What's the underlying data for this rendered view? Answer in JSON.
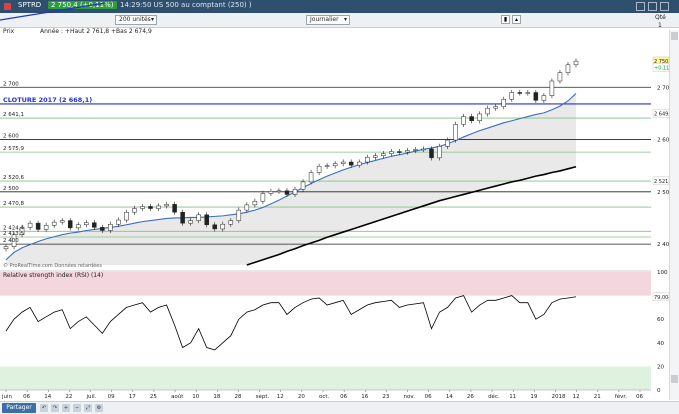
{
  "window": {
    "title": "SPTRD",
    "price_badge": "2 750,4 (+0,11%)",
    "info": "14:29:50 US 500 au comptant (250) )"
  },
  "toolbar": {
    "units_select": "200 unités",
    "period_select": "Journalier",
    "qte_label": "Qté",
    "qte_value": "1"
  },
  "chart_data": [
    {
      "type": "line",
      "x": [
        "juin",
        "06",
        "14",
        "22",
        "juil.",
        "09",
        "17",
        "25",
        "août",
        "10",
        "18",
        "28",
        "sept.",
        "12",
        "20",
        "oct.",
        "06",
        "16",
        "23",
        "nov.",
        "06",
        "14",
        "26",
        "déc.",
        "11",
        "19",
        "2018",
        "12",
        "21",
        "févr.",
        "06"
      ],
      "ylim": [
        2360,
        2800
      ],
      "yticks": [
        2700,
        2600,
        2500,
        2400
      ],
      "ytick_labels": [
        "2 700",
        "2 600",
        "2 500",
        "2 400"
      ],
      "corner_label": "Prix",
      "header_text": "Année : +Haut 2 761,8 +Bas 2 674,9",
      "series": [
        {
          "name": "",
          "color": "#111111",
          "values": [
            2395,
            2418,
            2432,
            2440,
            2428,
            2436,
            2442,
            2445,
            2431,
            2437,
            2441,
            2432,
            2426,
            2438,
            2446,
            2461,
            2468,
            2472,
            2468,
            2473,
            2476,
            2461,
            2440,
            2445,
            2456,
            2437,
            2429,
            2438,
            2445,
            2465,
            2475,
            2482,
            2497,
            2501,
            2502,
            2495,
            2505,
            2519,
            2537,
            2549,
            2550,
            2554,
            2557,
            2551,
            2557,
            2566,
            2569,
            2573,
            2577,
            2576,
            2579,
            2581,
            2582,
            2565,
            2587,
            2599,
            2629,
            2644,
            2636,
            2649,
            2660,
            2663,
            2677,
            2690,
            2689,
            2690,
            2675,
            2684,
            2712,
            2728,
            2743,
            2750
          ]
        },
        {
          "name": "",
          "color": "#3a6fbf",
          "values": [
            2370,
            2384,
            2393,
            2399,
            2405,
            2410,
            2414,
            2418,
            2421,
            2423,
            2426,
            2428,
            2430,
            2432,
            2434,
            2437,
            2440,
            2443,
            2445,
            2447,
            2449,
            2450,
            2450,
            2451,
            2451,
            2452,
            2453,
            2454,
            2456,
            2458,
            2461,
            2465,
            2470,
            2477,
            2484,
            2492,
            2500,
            2508,
            2516,
            2523,
            2530,
            2536,
            2542,
            2547,
            2552,
            2556,
            2560,
            2564,
            2568,
            2571,
            2574,
            2578,
            2581,
            2584,
            2587,
            2592,
            2598,
            2605,
            2611,
            2617,
            2622,
            2627,
            2632,
            2636,
            2640,
            2644,
            2648,
            2651,
            2657,
            2664,
            2674,
            2688
          ]
        },
        {
          "name": "",
          "color": "#000000",
          "values": [
            2213,
            2216,
            2219,
            2222,
            2226,
            2230,
            2234,
            2238,
            2243,
            2248,
            2254,
            2260,
            2266,
            2272,
            2278,
            2284,
            2289,
            2295,
            2300,
            2305,
            2310,
            2315,
            2320,
            2325,
            2330,
            2335,
            2340,
            2345,
            2350,
            2355,
            2360,
            2365,
            2370,
            2375,
            2380,
            2386,
            2391,
            2397,
            2402,
            2407,
            2413,
            2418,
            2423,
            2428,
            2433,
            2438,
            2443,
            2448,
            2453,
            2458,
            2463,
            2468,
            2473,
            2478,
            2483,
            2487,
            2491,
            2495,
            2499,
            2503,
            2507,
            2511,
            2515,
            2519,
            2522,
            2526,
            2530,
            2533,
            2537,
            2540,
            2544,
            2548
          ]
        }
      ],
      "levels": [
        {
          "value": 2700,
          "label": "2 700",
          "color": "#222222"
        },
        {
          "value": 2668.1,
          "label": "CLOTURE 2017 (2 668,1)",
          "color": "#2233cc"
        },
        {
          "value": 2641.1,
          "label": "2 641,1",
          "color": "#7fc37f"
        },
        {
          "value": 2600,
          "label": "2 600",
          "color": "#222222"
        },
        {
          "value": 2575.9,
          "label": "2 575,9",
          "color": "#7fc37f"
        },
        {
          "value": 2520.6,
          "label": "2 520,6",
          "color": "#7fc37f"
        },
        {
          "value": 2500,
          "label": "2 500",
          "color": "#222222"
        },
        {
          "value": 2470.8,
          "label": "2 470,8",
          "color": "#7fc37f"
        },
        {
          "value": 2424.4,
          "label": "2 424,4",
          "color": "#7fc37f"
        },
        {
          "value": 2413.5,
          "label": "2 413,5",
          "color": "#7fc37f"
        },
        {
          "value": 2400,
          "label": "2 400",
          "color": "#222222"
        }
      ],
      "price_tags": [
        {
          "value": 2750.4,
          "label": "2 750,4",
          "bg": "#fff59a"
        },
        {
          "value": 2738,
          "label": "+0,11%",
          "bg": "#ffffff"
        },
        {
          "value": 2649.4,
          "label": "2 649,4",
          "bg": "#ffffff"
        },
        {
          "value": 2521.0,
          "label": "2 521,0",
          "bg": "#ffffff"
        }
      ],
      "copyright": "© ProRealTime.com Données retardées"
    },
    {
      "type": "line",
      "title": "Relative strength index (RSI) (14)",
      "ylim": [
        0,
        100
      ],
      "yticks": [
        100,
        80,
        60,
        40,
        20,
        0
      ],
      "ytick_labels": [
        "100",
        "80",
        "60",
        "40",
        "20",
        "0"
      ],
      "current_label": "79,004",
      "zones": [
        {
          "from": 80,
          "to": 100,
          "color": "#f4d6de"
        },
        {
          "from": 0,
          "to": 20,
          "color": "#dff2df"
        }
      ],
      "series": [
        {
          "name": "",
          "color": "#000000",
          "values": [
            50,
            60,
            66,
            70,
            58,
            62,
            66,
            68,
            52,
            58,
            62,
            55,
            48,
            58,
            64,
            70,
            72,
            74,
            66,
            70,
            72,
            55,
            36,
            40,
            52,
            36,
            34,
            40,
            46,
            60,
            66,
            68,
            72,
            74,
            74,
            64,
            70,
            74,
            77,
            78,
            72,
            74,
            76,
            64,
            68,
            72,
            74,
            75,
            76,
            70,
            72,
            73,
            74,
            52,
            66,
            70,
            78,
            80,
            66,
            72,
            76,
            76,
            78,
            80,
            74,
            74,
            60,
            64,
            74,
            77,
            78,
            79
          ]
        }
      ]
    }
  ]
}
